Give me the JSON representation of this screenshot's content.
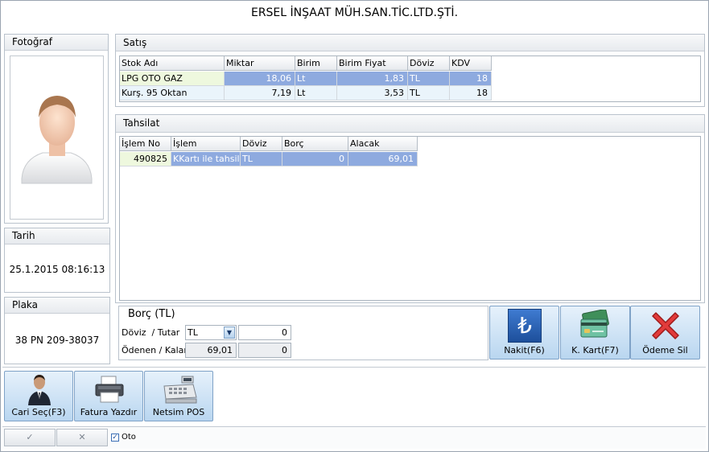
{
  "company_title": "ERSEL İNŞAAT MÜH.SAN.TİC.LTD.ŞTİ.",
  "left": {
    "photo_label": "Fotoğraf",
    "date_label": "Tarih",
    "date_value": "25.1.2015 08:16:13",
    "plate_label": "Plaka",
    "plate_value": "38 PN 209-38037"
  },
  "sales": {
    "title": "Satış",
    "headers": [
      "Stok Adı",
      "Miktar",
      "Birim",
      "Birim Fiyat",
      "Döviz",
      "KDV"
    ],
    "rows": [
      [
        "LPG OTO GAZ",
        "18,06",
        "Lt",
        "1,83",
        "TL",
        "18"
      ],
      [
        "Kurş. 95 Oktan",
        "7,19",
        "Lt",
        "3,53",
        "TL",
        "18"
      ]
    ]
  },
  "collection": {
    "title": "Tahsilat",
    "headers": [
      "İşlem No",
      "İşlem",
      "Döviz",
      "Borç",
      "Alacak"
    ],
    "rows": [
      [
        "490825",
        "KKartı ile tahsilat",
        "TL",
        "0",
        "69,01"
      ]
    ]
  },
  "debt": {
    "title": "Borç (TL)",
    "currency_amount_label": "Döviz  / Tutar",
    "paid_remaining_label": "Ödenen / Kalan",
    "currency_value": "TL",
    "amount_value": "0",
    "paid_value": "69,01",
    "remaining_value": "0"
  },
  "payment_buttons": {
    "cash": "Nakit(F6)",
    "card": "K. Kart(F7)",
    "delete": "Ödeme Sil"
  },
  "bottom_buttons": {
    "select_account": "Cari Seç(F3)",
    "print_invoice": "Fatura Yazdır",
    "pos": "Netsim POS"
  },
  "footer": {
    "ok_symbol": "✓",
    "cancel_symbol": "✕",
    "auto_label": "Oto",
    "auto_checked": true
  }
}
